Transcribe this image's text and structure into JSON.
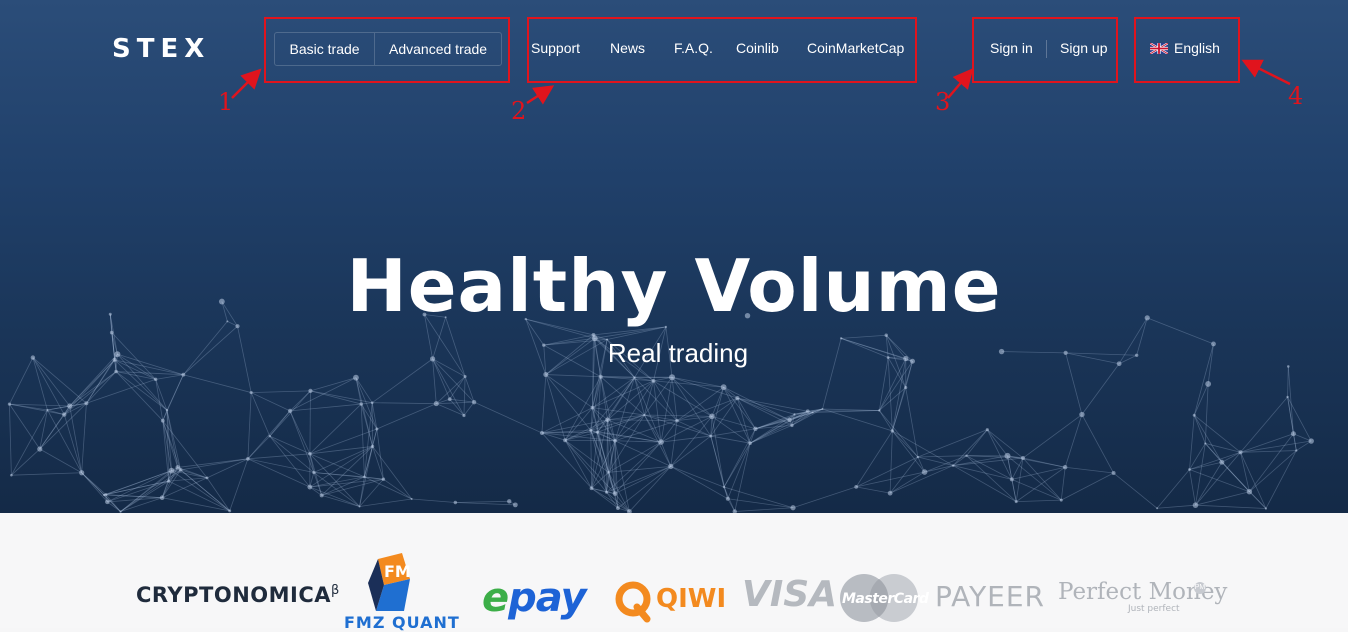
{
  "header": {
    "logo": "STEX",
    "trade_buttons": {
      "basic": "Basic trade",
      "advanced": "Advanced trade"
    },
    "nav": [
      "Support",
      "News",
      "F.A.Q.",
      "Coinlib",
      "CoinMarketCap"
    ],
    "auth": {
      "sign_in": "Sign in",
      "sign_up": "Sign up"
    },
    "language": "English"
  },
  "hero": {
    "title": "Healthy Volume",
    "subtitle": "Real trading"
  },
  "annotations": [
    "1",
    "2",
    "3",
    "4"
  ],
  "partners": {
    "cryptonomica": "CRYPTONOMICA",
    "cryptonomica_sup": "β",
    "fmz_quant": "FMZ QUANT",
    "epay_e": "e",
    "epay_rest": "pay",
    "qiwi": "QIWI",
    "visa": "VISA",
    "mastercard": "MasterCard",
    "payeer": "PAYEER",
    "perfect_money": "Perfect Money",
    "perfect_money_tagline": "Just perfect",
    "perfect_money_badge": "PM"
  },
  "colors": {
    "annotation_red": "#e0141d",
    "hero_top": "#2b4d79",
    "hero_bottom": "#142a47",
    "epay_blue": "#1d63d6",
    "epay_green": "#3cae48",
    "qiwi_orange": "#f38a1f",
    "fmz_blue": "#1f6fd1"
  }
}
